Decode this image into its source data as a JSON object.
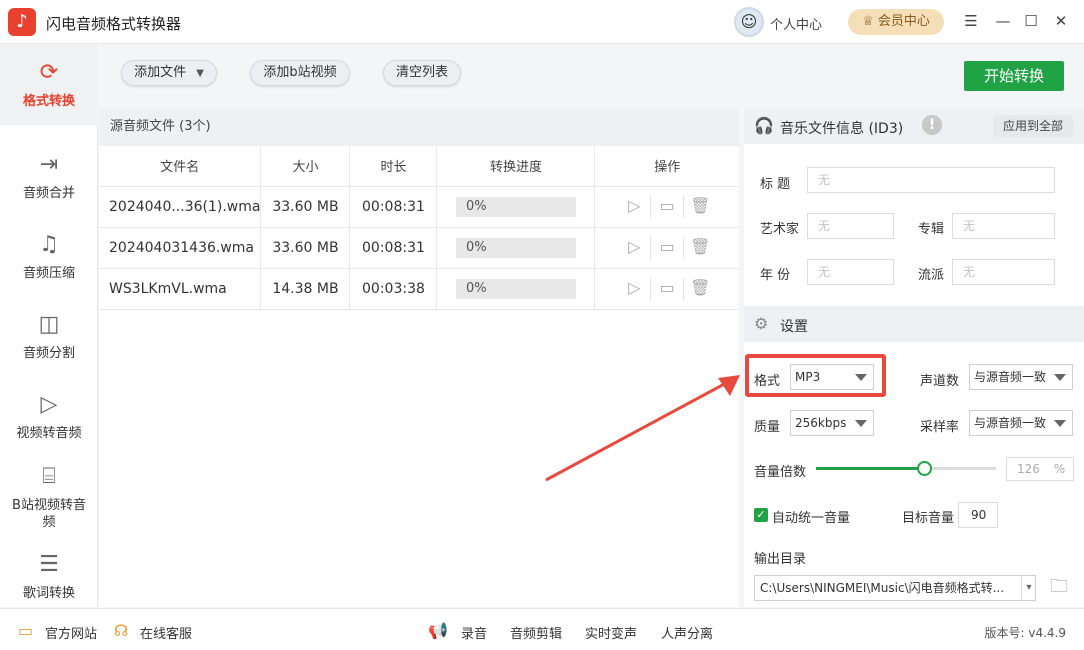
{
  "app": {
    "title": "闪电音频格式转换器",
    "logo": "music-note-icon"
  },
  "header": {
    "personal_center": "个人中心",
    "vip_center": "会员中心"
  },
  "sidebar": {
    "items": [
      {
        "label": "格式转换",
        "icon": "refresh-icon",
        "active": true
      },
      {
        "label": "音频合并",
        "icon": "merge-icon"
      },
      {
        "label": "音频压缩",
        "icon": "compress-icon"
      },
      {
        "label": "音频分割",
        "icon": "split-icon"
      },
      {
        "label": "视频转音频",
        "icon": "video-icon"
      },
      {
        "label": "B站视频转音频",
        "icon": "bilibili-icon"
      },
      {
        "label": "歌词转换",
        "icon": "lyrics-icon"
      }
    ]
  },
  "toolbar": {
    "add_file": "添加文件",
    "add_bilibili": "添加b站视频",
    "clear_list": "清空列表",
    "start": "开始转换"
  },
  "files": {
    "header": "源音频文件 (3个)",
    "columns": [
      "文件名",
      "大小",
      "时长",
      "转换进度",
      "操作"
    ],
    "rows": [
      {
        "name": "2024040...36(1).wma",
        "size": "33.60 MB",
        "duration": "00:08:31",
        "progress": "0%"
      },
      {
        "name": "202404031436.wma",
        "size": "33.60 MB",
        "duration": "00:08:31",
        "progress": "0%"
      },
      {
        "name": "WS3LKmVL.wma",
        "size": "14.38 MB",
        "duration": "00:03:38",
        "progress": "0%"
      }
    ]
  },
  "id3": {
    "title": "音乐文件信息 (ID3)",
    "apply_all": "应用到全部",
    "labels": {
      "title": "标 题",
      "artist": "艺术家",
      "album": "专辑",
      "year": "年 份",
      "genre": "流派"
    },
    "placeholder": "无"
  },
  "settings": {
    "title": "设置",
    "format_label": "格式",
    "format_value": "MP3",
    "channels_label": "声道数",
    "channels_value": "与源音频一致",
    "quality_label": "质量",
    "quality_value": "256kbps",
    "samplerate_label": "采样率",
    "samplerate_value": "与源音频一致",
    "volume_label": "音量倍数",
    "volume_value": "126",
    "volume_unit": "%",
    "volume_fraction": 0.6,
    "auto_volume_label": "自动统一音量",
    "auto_volume_checked": true,
    "target_volume_label": "目标音量",
    "target_volume_value": "90",
    "output_label": "输出目录",
    "output_path": "C:\\Users\\NINGMEI\\Music\\闪电音频格式转..."
  },
  "bottom": {
    "website": "官方网站",
    "support": "在线客服",
    "record": "录音",
    "audio_edit": "音频剪辑",
    "realtime_voice": "实时变声",
    "vocal_sep": "人声分离",
    "version": "版本号: v4.4.9"
  },
  "colors": {
    "accent_red": "#e8412f",
    "accent_green": "#20a344",
    "highlight": "#e94a3f"
  }
}
